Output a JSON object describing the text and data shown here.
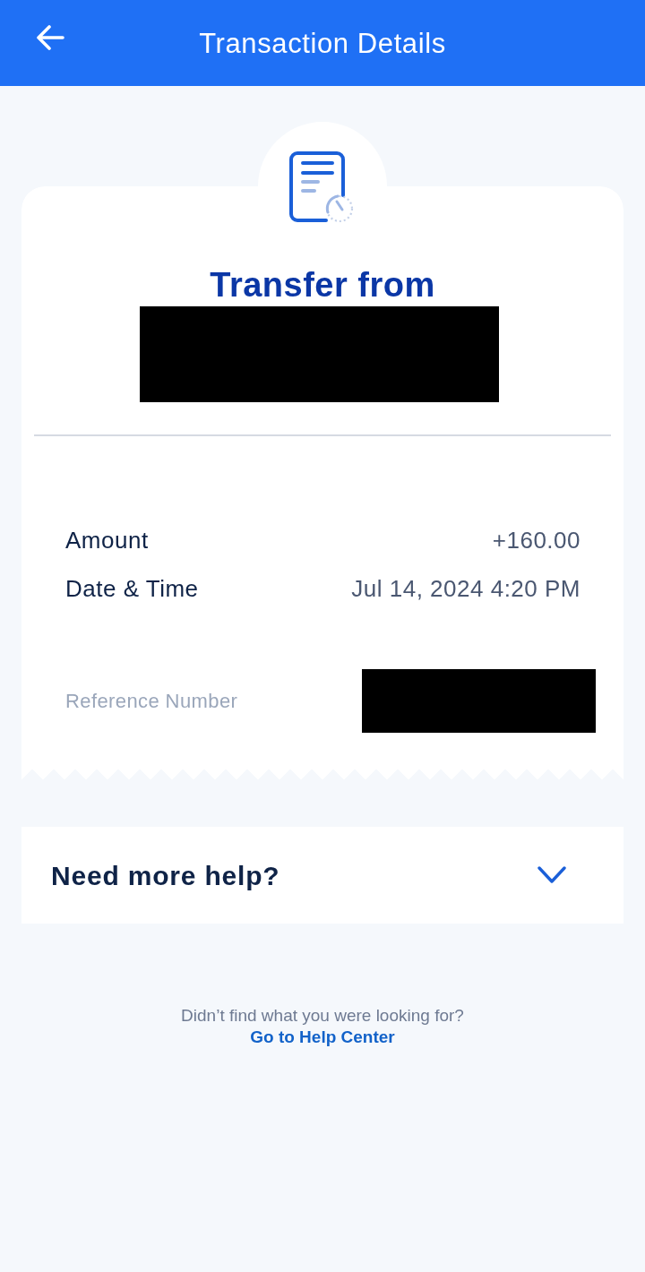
{
  "header": {
    "title": "Transaction Details"
  },
  "receipt": {
    "title": "Transfer from",
    "sender_redacted": true,
    "details": [
      {
        "label": "Amount",
        "value": "+160.00"
      },
      {
        "label": "Date & Time",
        "value": "Jul 14, 2024 4:20 PM"
      }
    ],
    "reference": {
      "label": "Reference Number",
      "value_redacted": true
    }
  },
  "help": {
    "title": "Need more help?",
    "expanded": false
  },
  "footer": {
    "text": "Didn’t find what you were looking for?",
    "link": "Go to Help Center"
  }
}
